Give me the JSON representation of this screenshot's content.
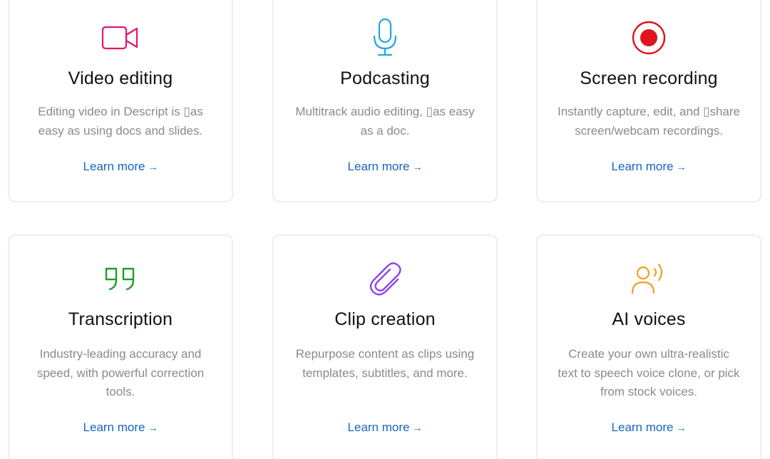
{
  "cards": [
    {
      "icon": "video-camera-icon",
      "title": "Video editing",
      "description": "Editing video in Descript is ▯as easy as using docs and slides.",
      "link": "Learn more",
      "arrow": "→",
      "color": "#e0186c"
    },
    {
      "icon": "microphone-icon",
      "title": "Podcasting",
      "description": "Multitrack audio editing, ▯as easy as a doc.",
      "link": "Learn more",
      "arrow": "→",
      "color": "#1ea7e1"
    },
    {
      "icon": "record-icon",
      "title": "Screen recording",
      "description": "Instantly capture, edit, and ▯share screen/webcam recordings.",
      "link": "Learn more",
      "arrow": "→",
      "color": "#e0131e"
    },
    {
      "icon": "quote-icon",
      "title": "Transcription",
      "description": "Industry-leading accuracy and speed, with powerful correction tools.",
      "link": "Learn more",
      "arrow": "→",
      "color": "#1f9d2a"
    },
    {
      "icon": "paperclip-icon",
      "title": "Clip creation",
      "description": "Repurpose content as clips using templates, subtitles, and more.",
      "link": "Learn more",
      "arrow": "→",
      "color": "#8e44e8"
    },
    {
      "icon": "ai-voice-icon",
      "title": "AI voices",
      "description": "Create your own ultra-realistic text to speech voice clone, or pick from stock voices.",
      "link": "Learn more",
      "arrow": "→",
      "color": "#f0a020"
    }
  ],
  "link_color": "#1565c0"
}
